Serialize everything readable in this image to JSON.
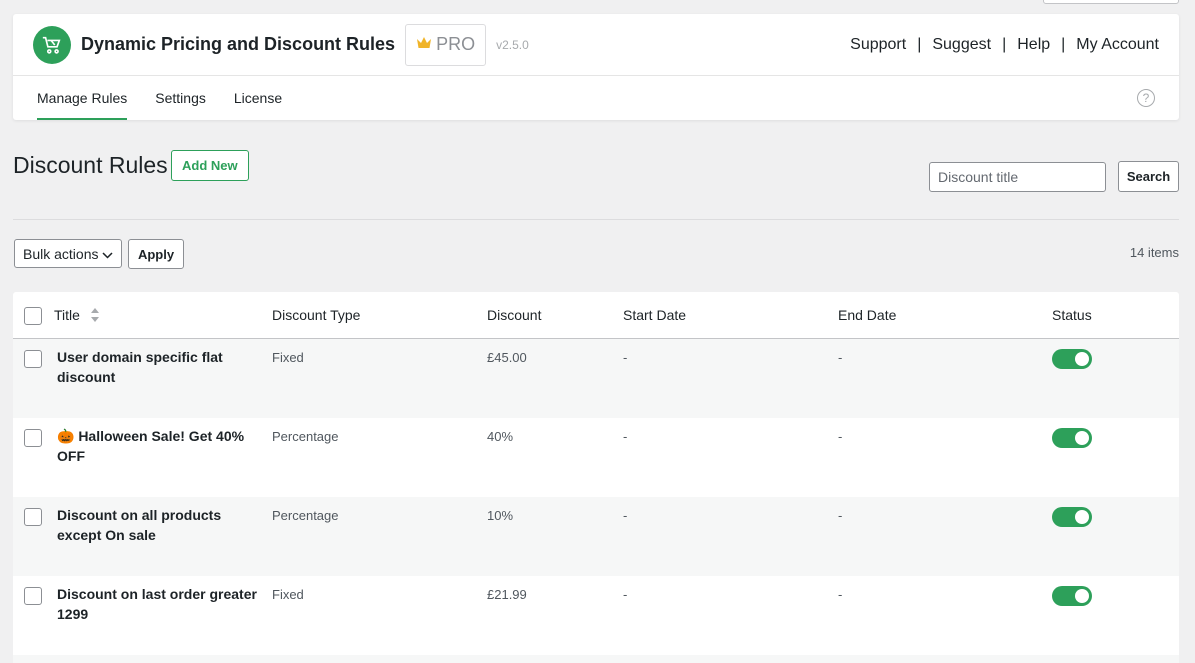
{
  "header": {
    "brand_title": "Dynamic Pricing and Discount Rules",
    "pro_label": "PRO",
    "version": "v2.5.0",
    "links": [
      "Support",
      "Suggest",
      "Help",
      "My Account"
    ],
    "link_separator": "|",
    "help_glyph": "?"
  },
  "nav": {
    "tabs": [
      "Manage Rules",
      "Settings",
      "License"
    ],
    "active_tab": "Manage Rules"
  },
  "page": {
    "title": "Discount Rules",
    "add_new": "Add New",
    "search_placeholder": "Discount title",
    "search_button": "Search",
    "bulk_actions": "Bulk actions",
    "apply": "Apply",
    "items_count": "14 items"
  },
  "table": {
    "columns": [
      "Title",
      "Discount Type",
      "Discount",
      "Start Date",
      "End Date",
      "Status"
    ],
    "rows": [
      {
        "title": "User domain specific flat discount",
        "type": "Fixed",
        "discount": "£45.00",
        "start": "-",
        "end": "-",
        "enabled": true
      },
      {
        "title": "🎃 Halloween Sale! Get 40% OFF",
        "type": "Percentage",
        "discount": "40%",
        "start": "-",
        "end": "-",
        "enabled": true
      },
      {
        "title": "Discount on all products except On sale",
        "type": "Percentage",
        "discount": "10%",
        "start": "-",
        "end": "-",
        "enabled": true
      },
      {
        "title": "Discount on last order greater 1299",
        "type": "Fixed",
        "discount": "£21.99",
        "start": "-",
        "end": "-",
        "enabled": true
      }
    ]
  },
  "colors": {
    "accent": "#2da05a",
    "background": "#f0f0f1",
    "crown": "#f0b429"
  },
  "icons": {
    "logo": "cart-discount-logo-icon",
    "pro": "crown-icon",
    "sort": "sort-arrows-icon",
    "bulk_caret": "chevron-down-icon",
    "help": "question-circle-icon"
  }
}
